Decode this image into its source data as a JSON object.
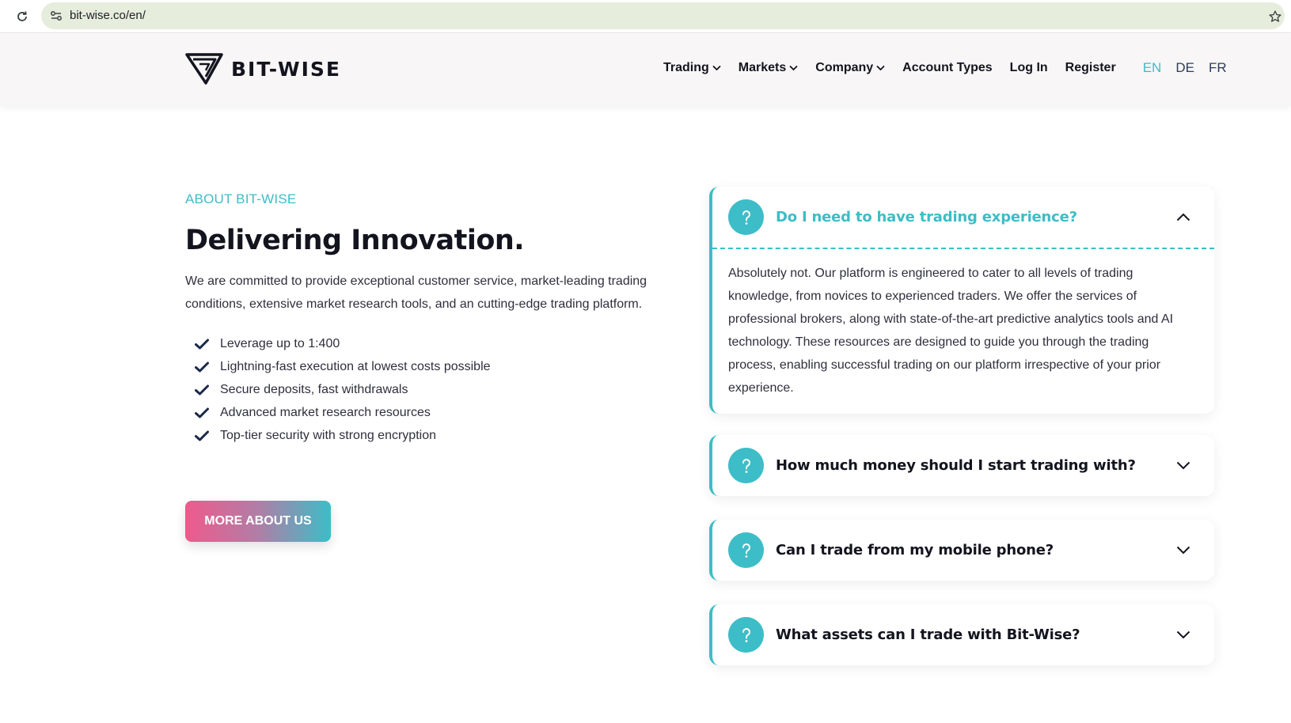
{
  "browser": {
    "url": "bit-wise.co/en/"
  },
  "header": {
    "logo_text": "BIT-WISE",
    "nav": [
      {
        "label": "Trading",
        "dropdown": true
      },
      {
        "label": "Markets",
        "dropdown": true
      },
      {
        "label": "Company",
        "dropdown": true
      },
      {
        "label": "Account Types",
        "dropdown": false
      },
      {
        "label": "Log In",
        "dropdown": false
      },
      {
        "label": "Register",
        "dropdown": false
      }
    ],
    "languages": [
      "EN",
      "DE",
      "FR"
    ],
    "active_language": "EN"
  },
  "about": {
    "eyebrow": "ABOUT BIT-WISE",
    "heading": "Delivering Innovation.",
    "description": "We are committed to provide exceptional customer service, market-leading trading conditions, extensive market research tools, and an cutting-edge trading platform.",
    "features": [
      "Leverage up to 1:400",
      "Lightning-fast execution at lowest costs possible",
      "Secure deposits, fast withdrawals",
      "Advanced market research resources",
      "Top-tier security with strong encryption"
    ],
    "cta_label": "MORE ABOUT US"
  },
  "faq": [
    {
      "question": "Do I need to have trading experience?",
      "expanded": true,
      "answer": "Absolutely not. Our platform is engineered to cater to all levels of trading knowledge, from novices to experienced traders. We offer the services of professional brokers, along with state-of-the-art predictive analytics tools and AI technology. These resources are designed to guide you through the trading process, enabling successful trading on our platform irrespective of your prior experience."
    },
    {
      "question": "How much money should I start trading with?",
      "expanded": false
    },
    {
      "question": "Can I trade from my mobile phone?",
      "expanded": false
    },
    {
      "question": "What assets can I trade with Bit-Wise?",
      "expanded": false
    }
  ],
  "colors": {
    "accent": "#3dbdc7",
    "gradient_start": "#ef5a8c",
    "text_dark": "#14141f",
    "header_bg": "#f8f6f6",
    "omnibox_bg": "#e6eddd"
  },
  "icons": {
    "reload": "reload-icon",
    "site_info": "site-info-icon",
    "bookmark": "star-icon",
    "check": "check-icon",
    "question": "question-icon",
    "chevron_up": "chevron-up-icon",
    "chevron_down": "chevron-down-icon"
  }
}
